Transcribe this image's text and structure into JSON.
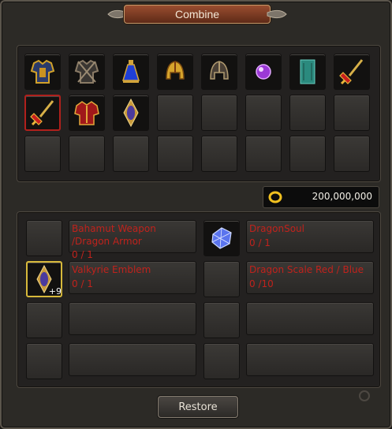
{
  "window": {
    "title": "Combine"
  },
  "gold": {
    "amount": "200,000,000"
  },
  "inventory": [
    {
      "icon": "armor-chest-gold-icon"
    },
    {
      "icon": "armor-chest-dark-icon"
    },
    {
      "icon": "blue-potion-icon"
    },
    {
      "icon": "golden-helmet-icon"
    },
    {
      "icon": "dark-helmet-icon"
    },
    {
      "icon": "purple-gem-icon"
    },
    {
      "icon": "teal-banner-icon"
    },
    {
      "icon": "dragon-sword-icon"
    },
    {
      "icon": "dragon-sword-selected-icon",
      "selected": true
    },
    {
      "icon": "red-armor-icon"
    },
    {
      "icon": "valkyrie-emblem-icon"
    }
  ],
  "materials": [
    {
      "name": "Bahamut Weapon /Dragon Armor",
      "count": "0 / 1",
      "icon": null
    },
    {
      "name": "DragonSoul",
      "count": "0 / 1",
      "icon": "dragon-soul-crystal-icon"
    },
    {
      "name": "Valkyrie Emblem",
      "count": "0 / 1",
      "icon": "valkyrie-emblem-icon",
      "plus": "+9"
    },
    {
      "name": "Dragon Scale Red / Blue",
      "count": "0 /10",
      "icon": null
    }
  ],
  "restore_button": {
    "label": "Restore"
  }
}
